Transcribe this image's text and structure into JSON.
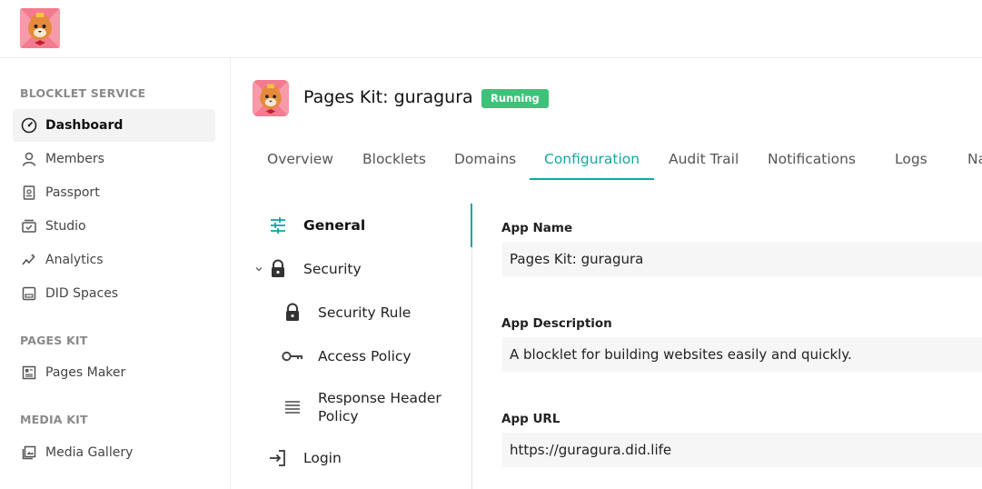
{
  "sidebar": {
    "sections": [
      {
        "title": "BLOCKLET SERVICE"
      },
      {
        "title": "PAGES KIT"
      },
      {
        "title": "MEDIA KIT"
      }
    ],
    "items": [
      {
        "label": "Dashboard"
      },
      {
        "label": "Members"
      },
      {
        "label": "Passport"
      },
      {
        "label": "Studio"
      },
      {
        "label": "Analytics"
      },
      {
        "label": "DID Spaces"
      },
      {
        "label": "Pages Maker"
      },
      {
        "label": "Media Gallery"
      }
    ]
  },
  "header": {
    "title": "Pages Kit: guragura",
    "status": "Running",
    "status_color": "#3ec27a"
  },
  "tabs": [
    {
      "label": "Overview"
    },
    {
      "label": "Blocklets"
    },
    {
      "label": "Domains"
    },
    {
      "label": "Configuration"
    },
    {
      "label": "Audit Trail"
    },
    {
      "label": "Notifications"
    },
    {
      "label": "Logs"
    },
    {
      "label": "Na"
    }
  ],
  "subnav": {
    "general": "General",
    "security": "Security",
    "security_rule": "Security Rule",
    "access_policy": "Access Policy",
    "response_header_line1": "Response Header",
    "response_header_line2": "Policy",
    "login": "Login"
  },
  "form": {
    "app_name_label": "App Name",
    "app_name_value": "Pages Kit: guragura",
    "app_description_label": "App Description",
    "app_description_value": "A blocklet for building websites easily and quickly.",
    "app_url_label": "App URL",
    "app_url_value": "https://guragura.did.life"
  },
  "colors": {
    "accent": "#12a7a0"
  }
}
